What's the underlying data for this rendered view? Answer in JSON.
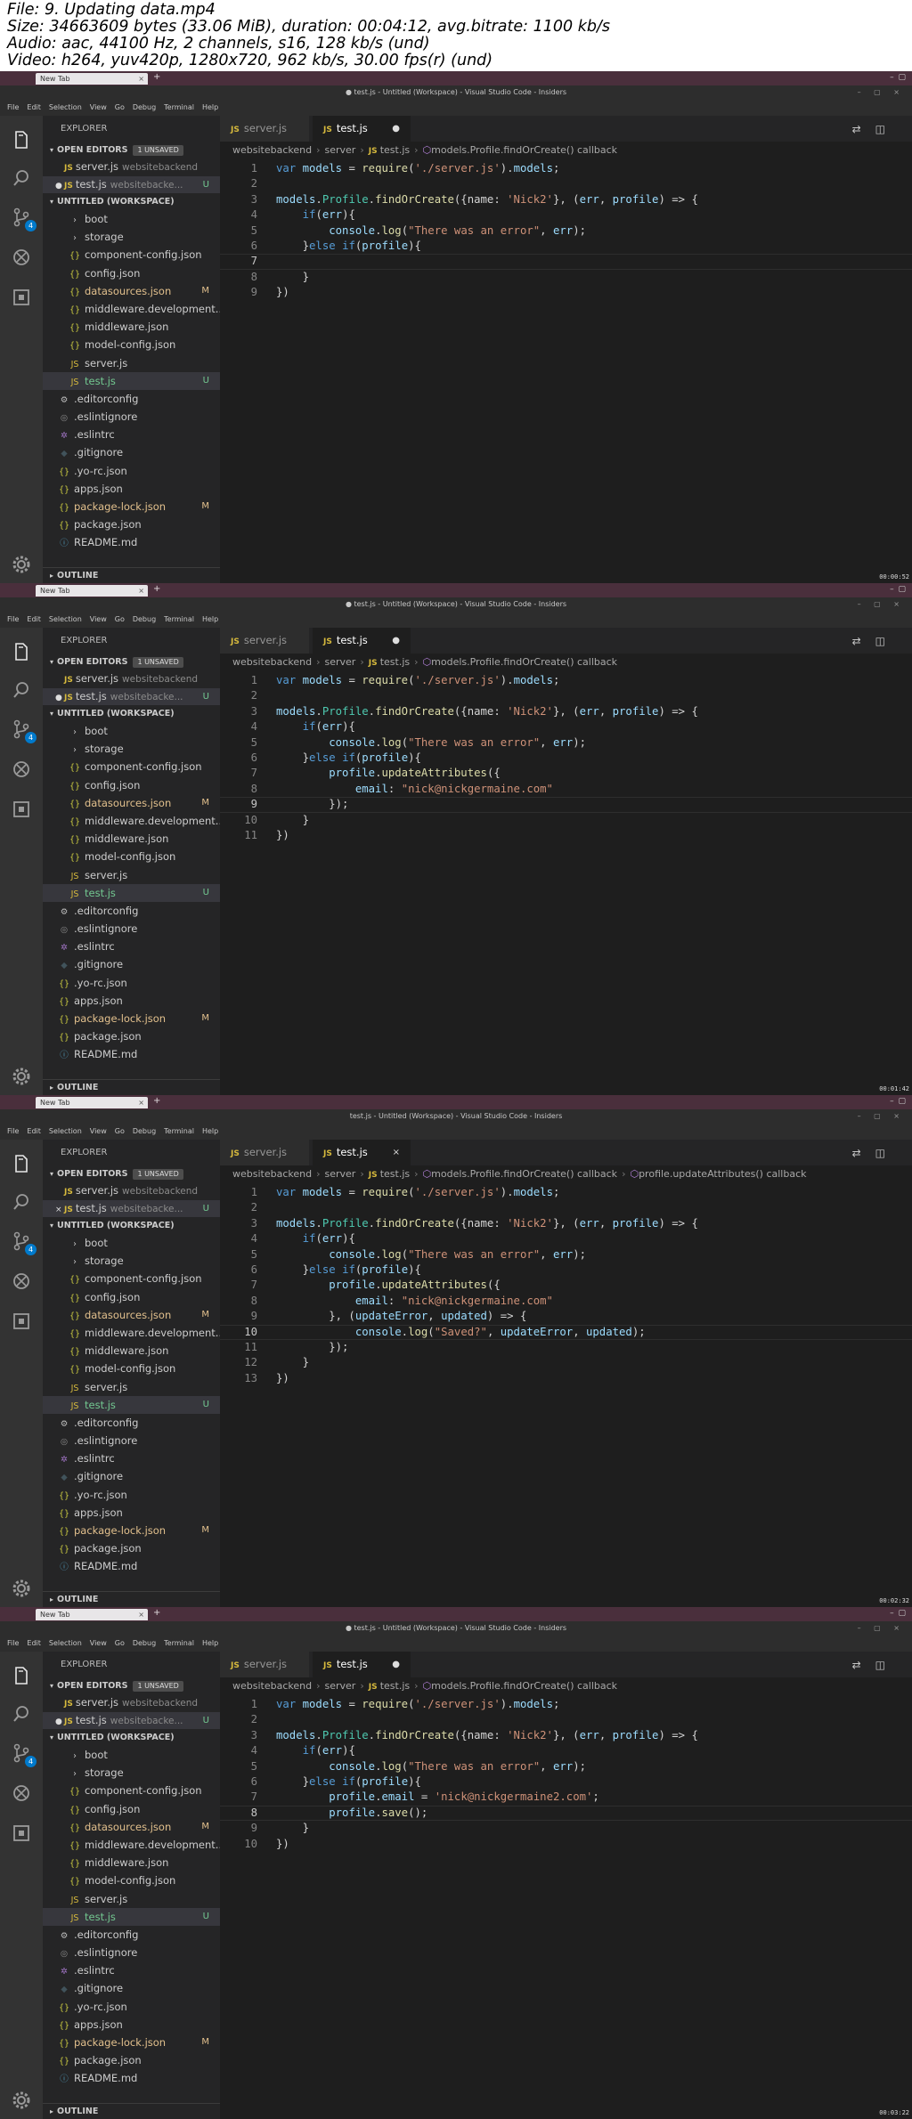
{
  "header": {
    "lines": [
      "File: 9. Updating data.mp4",
      "Size: 34663609 bytes (33.06 MiB), duration: 00:04:12, avg.bitrate: 1100 kb/s",
      "Audio: aac, 44100 Hz, 2 channels, s16, 128 kb/s (und)",
      "Video: h264, yuv420p, 1280x720, 962 kb/s, 30.00 fps(r) (und)"
    ]
  },
  "colors": {
    "accent": "#007acc",
    "modified": "#e2c08d",
    "untracked": "#73c991",
    "os_bar": "#4a2f3c"
  },
  "common": {
    "browser_tab": "New Tab",
    "menu": [
      "File",
      "Edit",
      "Selection",
      "View",
      "Go",
      "Debug",
      "Terminal",
      "Help"
    ],
    "explorer_title": "EXPLORER",
    "open_editors": "OPEN EDITORS",
    "unsaved_badge": "1 UNSAVED",
    "workspace": "UNTITLED (WORKSPACE)",
    "outline": "OUTLINE",
    "scm_badge": "4",
    "open_files": [
      {
        "name": "server.js",
        "path": "websitebackend"
      },
      {
        "name": "test.js",
        "path": "websitebacke...",
        "status": "U"
      }
    ],
    "tree": [
      {
        "name": "boot",
        "icon": "chevron-right",
        "indent": 1
      },
      {
        "name": "storage",
        "icon": "chevron-right",
        "indent": 1
      },
      {
        "name": "component-config.json",
        "icon": "json",
        "indent": 1
      },
      {
        "name": "config.json",
        "icon": "json",
        "indent": 1
      },
      {
        "name": "datasources.json",
        "icon": "json",
        "indent": 1,
        "status": "M"
      },
      {
        "name": "middleware.development...",
        "icon": "json",
        "indent": 1
      },
      {
        "name": "middleware.json",
        "icon": "json",
        "indent": 1
      },
      {
        "name": "model-config.json",
        "icon": "json",
        "indent": 1
      },
      {
        "name": "server.js",
        "icon": "js",
        "indent": 1
      },
      {
        "name": "test.js",
        "icon": "js",
        "indent": 1,
        "status": "U",
        "selected": true
      },
      {
        "name": ".editorconfig",
        "icon": "gear",
        "indent": 0
      },
      {
        "name": ".eslintignore",
        "icon": "circle",
        "indent": 0
      },
      {
        "name": ".eslintrc",
        "icon": "eslint",
        "indent": 0
      },
      {
        "name": ".gitignore",
        "icon": "git",
        "indent": 0
      },
      {
        "name": ".yo-rc.json",
        "icon": "json",
        "indent": 0
      },
      {
        "name": "apps.json",
        "icon": "json",
        "indent": 0
      },
      {
        "name": "package-lock.json",
        "icon": "json",
        "indent": 0,
        "status": "M"
      },
      {
        "name": "package.json",
        "icon": "json",
        "indent": 0
      },
      {
        "name": "README.md",
        "icon": "info",
        "indent": 0
      }
    ],
    "tabs": {
      "inactive": "server.js",
      "active": "test.js"
    }
  },
  "frames": [
    {
      "window_title": "● test.js - Untitled (Workspace) - Visual Studio Code - Insiders",
      "tab_mark": "●",
      "open_editor_mark": "●",
      "breadcrumb": [
        "websitebackend",
        "server",
        "test.js",
        "models.Profile.findOrCreate() callback"
      ],
      "current_line": 7,
      "timestamp": "00:00:52",
      "code": [
        "var models = require('./server.js').models;",
        "",
        "models.Profile.findOrCreate({name: 'Nick2'}, (err, profile) => {",
        "    if(err){",
        "        console.log(\"There was an error\", err);",
        "    }else if(profile){",
        "",
        "    }",
        "})"
      ]
    },
    {
      "window_title": "● test.js - Untitled (Workspace) - Visual Studio Code - Insiders",
      "tab_mark": "●",
      "open_editor_mark": "●",
      "breadcrumb": [
        "websitebackend",
        "server",
        "test.js",
        "models.Profile.findOrCreate() callback"
      ],
      "current_line": 9,
      "timestamp": "00:01:42",
      "code": [
        "var models = require('./server.js').models;",
        "",
        "models.Profile.findOrCreate({name: 'Nick2'}, (err, profile) => {",
        "    if(err){",
        "        console.log(\"There was an error\", err);",
        "    }else if(profile){",
        "        profile.updateAttributes({",
        "            email: \"nick@nickgermaine.com\"",
        "        });",
        "    }",
        "})"
      ]
    },
    {
      "window_title": "test.js - Untitled (Workspace) - Visual Studio Code - Insiders",
      "tab_mark": "×",
      "open_editor_mark": "×",
      "breadcrumb": [
        "websitebackend",
        "server",
        "test.js",
        "models.Profile.findOrCreate() callback",
        "profile.updateAttributes() callback"
      ],
      "current_line": 10,
      "timestamp": "00:02:32",
      "code": [
        "var models = require('./server.js').models;",
        "",
        "models.Profile.findOrCreate({name: 'Nick2'}, (err, profile) => {",
        "    if(err){",
        "        console.log(\"There was an error\", err);",
        "    }else if(profile){",
        "        profile.updateAttributes({",
        "            email: \"nick@nickgermaine.com\"",
        "        }, (updateError, updated) => {",
        "            console.log(\"Saved?\", updateError, updated);",
        "        });",
        "    }",
        "})"
      ]
    },
    {
      "window_title": "● test.js - Untitled (Workspace) - Visual Studio Code - Insiders",
      "tab_mark": "●",
      "open_editor_mark": "●",
      "breadcrumb": [
        "websitebackend",
        "server",
        "test.js",
        "models.Profile.findOrCreate() callback"
      ],
      "current_line": 8,
      "timestamp": "00:03:22",
      "code": [
        "var models = require('./server.js').models;",
        "",
        "models.Profile.findOrCreate({name: 'Nick2'}, (err, profile) => {",
        "    if(err){",
        "        console.log(\"There was an error\", err);",
        "    }else if(profile){",
        "        profile.email = 'nick@nickgermaine2.com';",
        "        profile.save();",
        "    }",
        "})"
      ]
    }
  ]
}
